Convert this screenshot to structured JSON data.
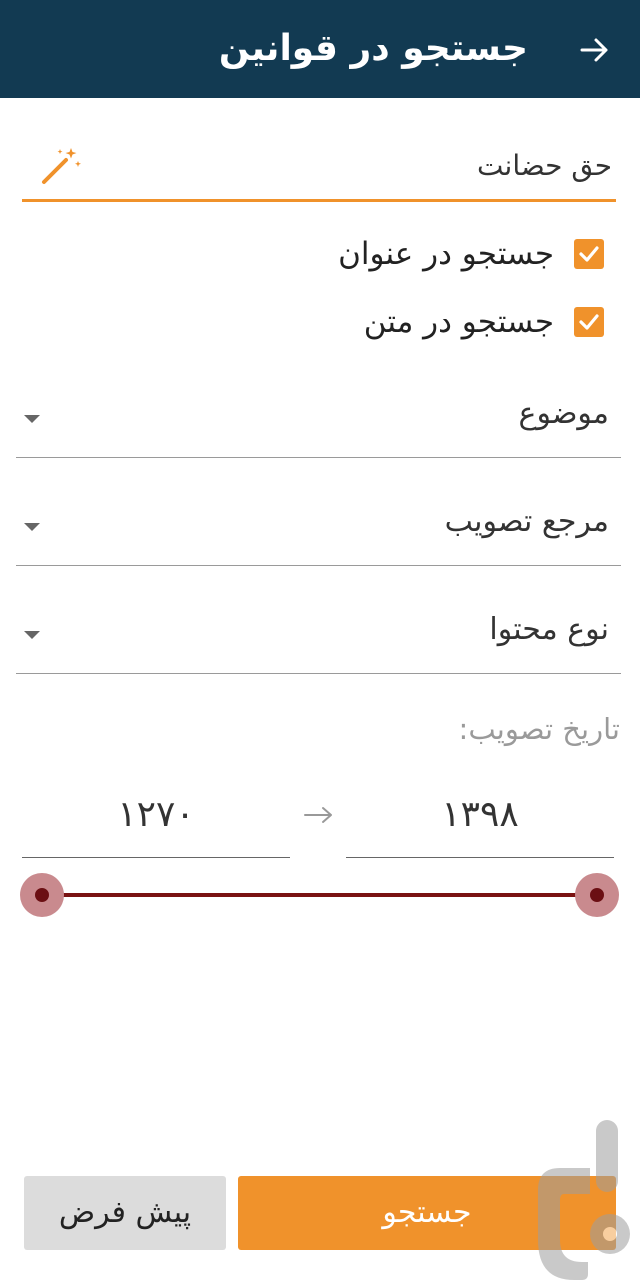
{
  "appbar": {
    "title": "جستجو در قوانین",
    "back_icon": "arrow-right-icon",
    "background": "#123a52"
  },
  "search": {
    "value": "حق حضانت",
    "icon": "magic-wand-icon",
    "accent": "#f0922b"
  },
  "checkboxes": [
    {
      "label": "جستجو در عنوان",
      "checked": true
    },
    {
      "label": "جستجو در متن",
      "checked": true
    }
  ],
  "dropdowns": [
    {
      "label": "موضوع"
    },
    {
      "label": "مرجع تصویب"
    },
    {
      "label": "نوع محتوا"
    }
  ],
  "date_range": {
    "label": "تاریخ تصویب:",
    "to_year": "۱۳۹۸",
    "from_year": "۱۲۷۰",
    "arrow": "→"
  },
  "slider": {
    "min_year": 1270,
    "max_year": 1398,
    "low": 1270,
    "high": 1398,
    "track_color": "#7a1212"
  },
  "buttons": {
    "search_label": "جستجو",
    "default_label": "پیش فرض"
  },
  "watermark": {
    "icon": "bazaar-logo-icon"
  }
}
